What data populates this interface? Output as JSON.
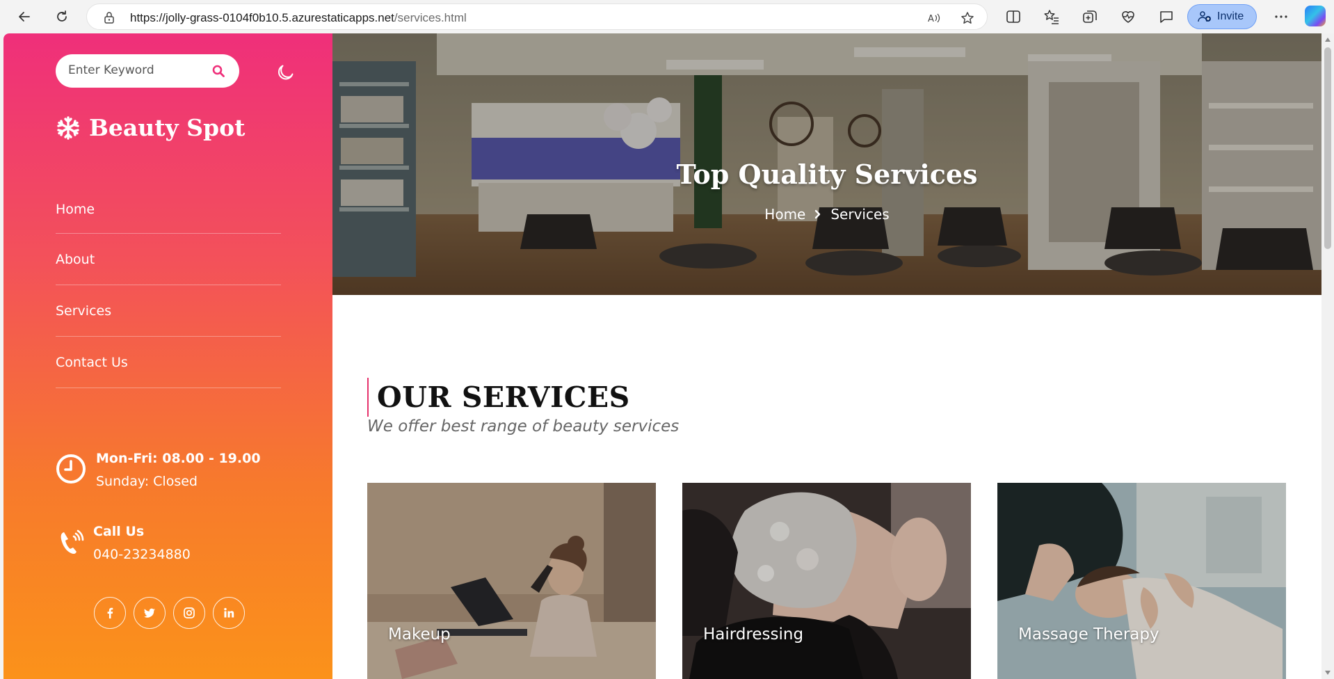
{
  "browser": {
    "url_host": "https://jolly-grass-0104f0b10.5.azurestaticapps.net",
    "url_path": "/services.html",
    "invite_label": "Invite"
  },
  "sidebar": {
    "search_placeholder": "Enter Keyword",
    "brand": "Beauty Spot",
    "menu": [
      {
        "label": "Home"
      },
      {
        "label": "About"
      },
      {
        "label": "Services"
      },
      {
        "label": "Contact Us"
      }
    ],
    "hours": {
      "title": "Mon-Fri: 08.00 - 19.00",
      "sub": "Sunday: Closed"
    },
    "call": {
      "title": "Call Us",
      "number": "040-23234880"
    },
    "socials": [
      "facebook-icon",
      "twitter-icon",
      "instagram-icon",
      "linkedin-icon"
    ]
  },
  "hero": {
    "title": "Top Quality Services",
    "breadcrumb": [
      "Home",
      "Services"
    ]
  },
  "services": {
    "heading": "OUR SERVICES",
    "subheading": "We offer best range of beauty services",
    "cards": [
      {
        "label": "Makeup"
      },
      {
        "label": "Hairdressing"
      },
      {
        "label": "Massage Therapy"
      }
    ]
  },
  "colors": {
    "accent": "#e6326c",
    "gradient_top": "#ef2f7a",
    "gradient_bottom": "#fb921a"
  }
}
